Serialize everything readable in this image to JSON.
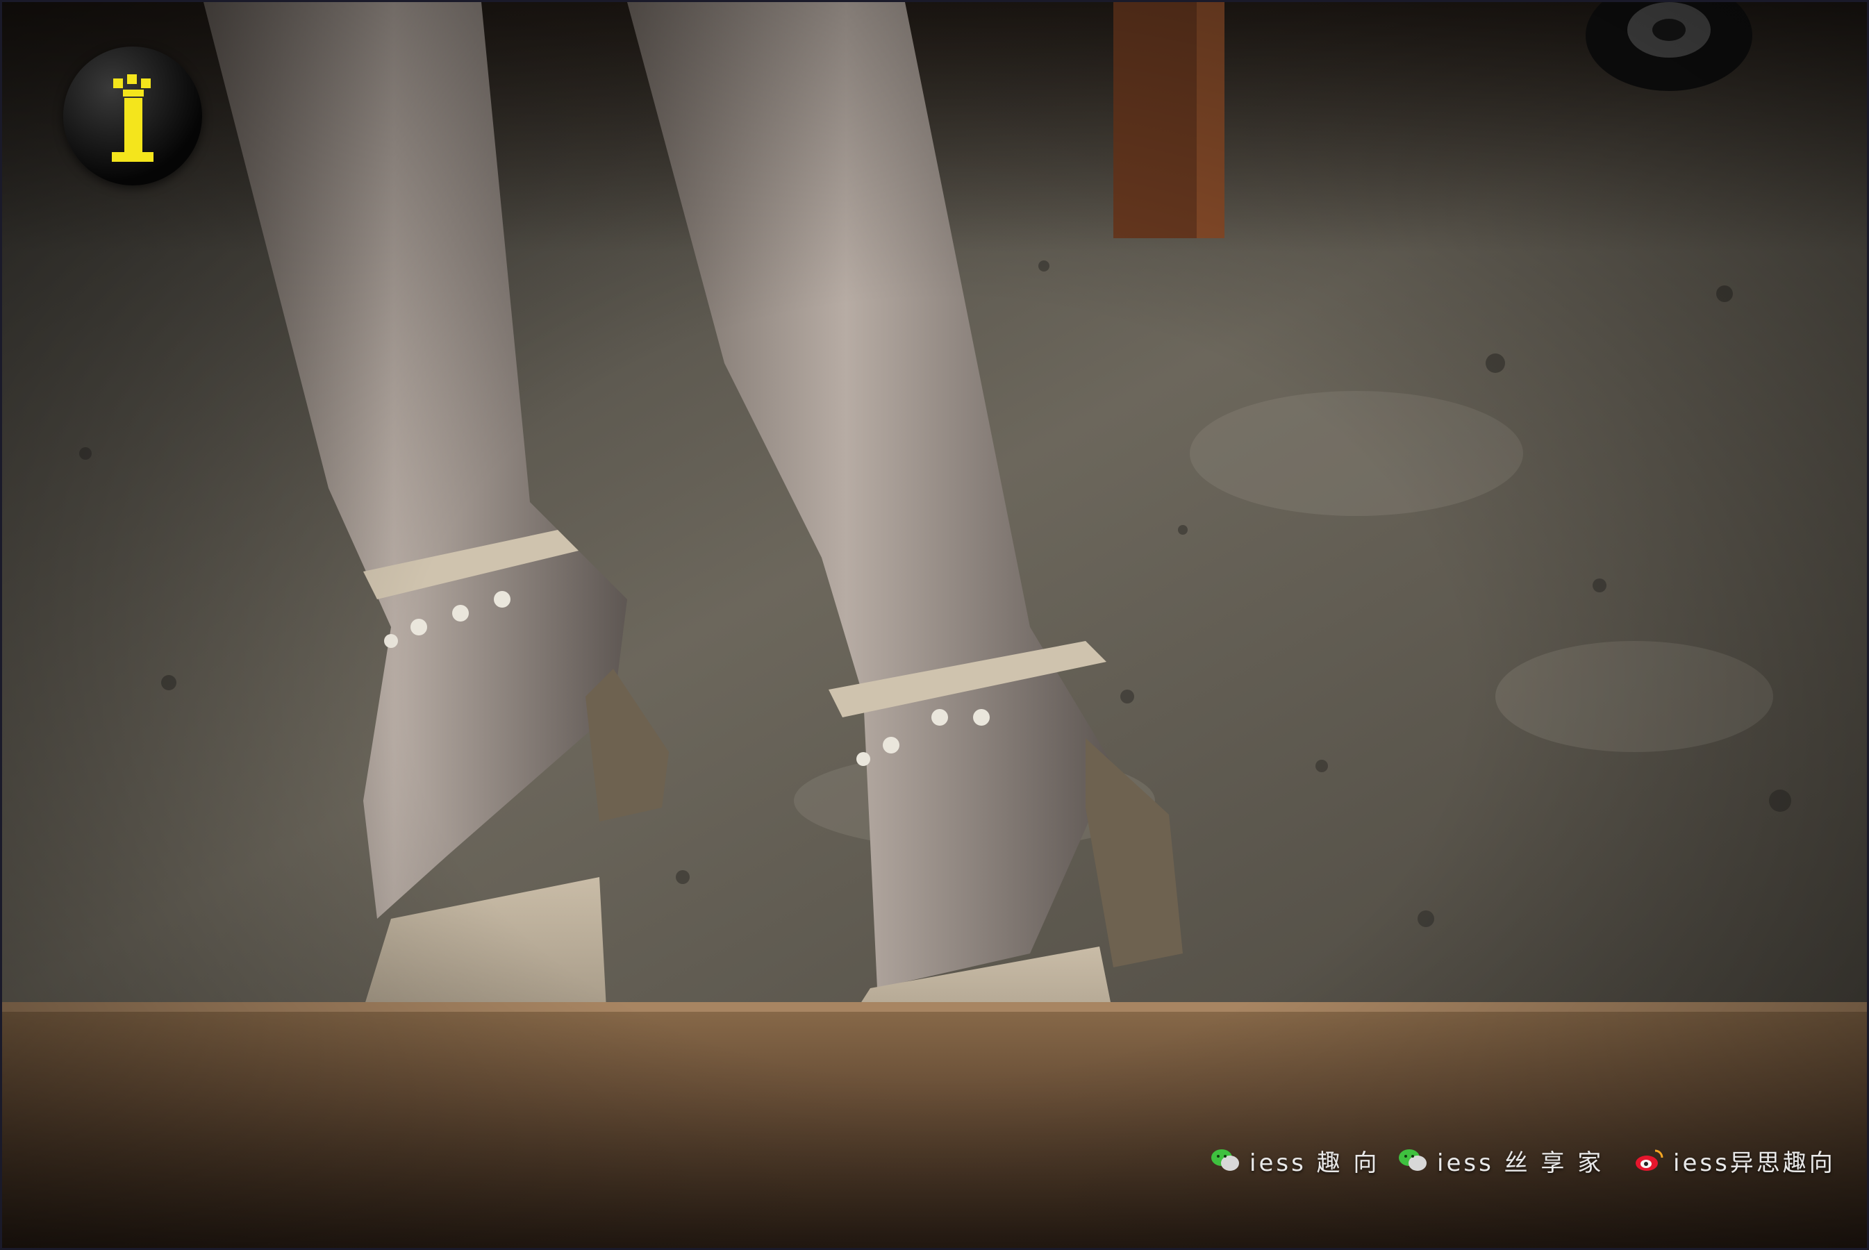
{
  "photo": {
    "description_icon": "photo-scene"
  },
  "logo": {
    "icon": "iess-logo-icon",
    "accent": "#f4e51c"
  },
  "watermarks": [
    {
      "icon": "wechat-icon",
      "text": "iess 趣 向"
    },
    {
      "icon": "wechat-icon",
      "text": "iess 丝 享 家"
    },
    {
      "icon": "weibo-icon",
      "text": "iess异思趣向"
    }
  ]
}
